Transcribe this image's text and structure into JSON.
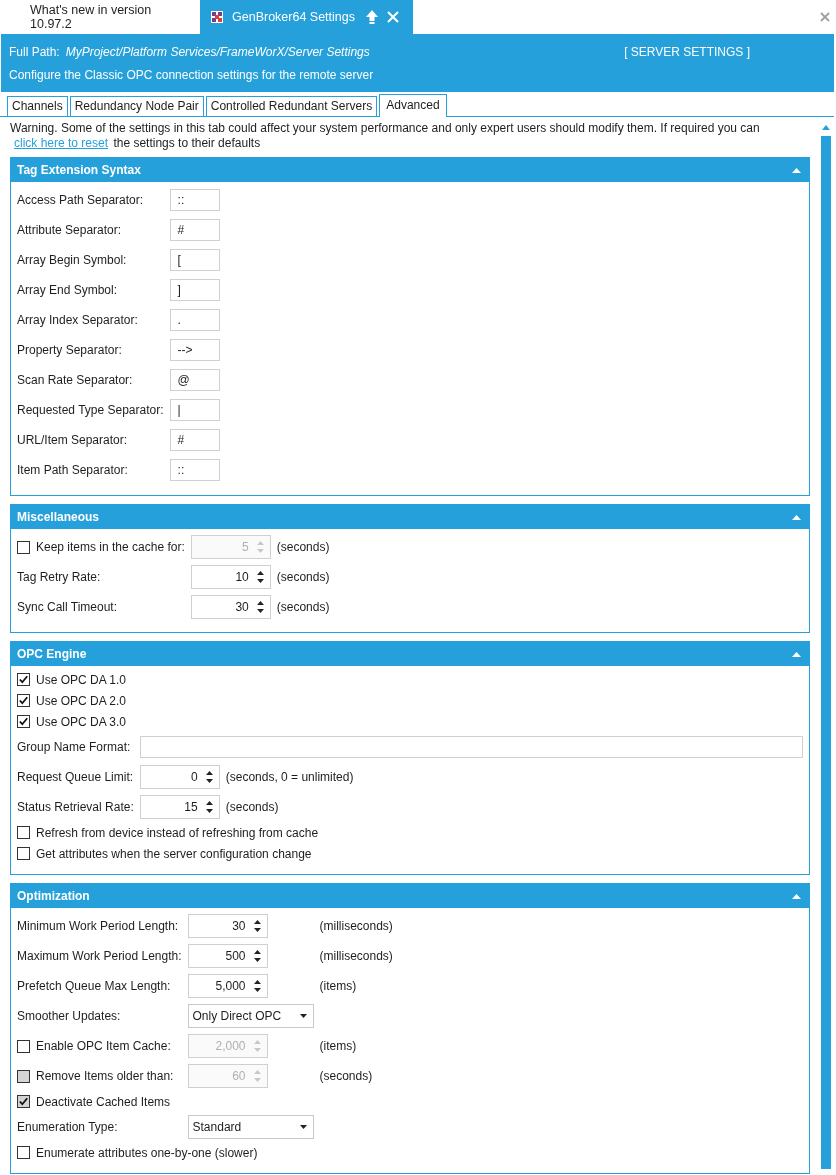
{
  "document_tabs": [
    {
      "label": "What's new in version 10.97.2",
      "selected": false
    },
    {
      "label": "GenBroker64 Settings",
      "selected": true
    }
  ],
  "header": {
    "path_label": "Full Path:",
    "path": "MyProject/Platform Services/FrameWorX/Server Settings",
    "title": "[ SERVER SETTINGS ]",
    "description": "Configure the Classic OPC connection settings for the remote server"
  },
  "tabs": [
    {
      "label": "Channels",
      "selected": false
    },
    {
      "label": "Redundancy Node Pair",
      "selected": false
    },
    {
      "label": "Controlled Redundant Servers",
      "selected": false
    },
    {
      "label": "Advanced",
      "selected": true
    }
  ],
  "warning": {
    "text": "Warning. Some of the settings in this tab could affect your system performance and only expert users should modify them.  If required you can ",
    "link": "click here to reset",
    "text_after": " the settings to their defaults"
  },
  "sections": [
    {
      "title": "Tag Extension Syntax",
      "expanded": true,
      "rows": [
        {
          "kind": "field",
          "label": "Access Path Separator:",
          "value": "::"
        },
        {
          "kind": "field",
          "label": "Attribute Separator:",
          "value": "#"
        },
        {
          "kind": "field",
          "label": "Array Begin Symbol:",
          "value": "["
        },
        {
          "kind": "field",
          "label": "Array End Symbol:",
          "value": "]"
        },
        {
          "kind": "field",
          "label": "Array Index Separator:",
          "value": "."
        },
        {
          "kind": "field",
          "label": "Property Separator:",
          "value": "-->"
        },
        {
          "kind": "field",
          "label": "Scan Rate Separator:",
          "value": "@"
        },
        {
          "kind": "field",
          "label": "Requested Type Separator:",
          "value": "|"
        },
        {
          "kind": "field",
          "label": "URL/Item Separator:",
          "value": "#"
        },
        {
          "kind": "field",
          "label": "Item Path Separator:",
          "value": "::"
        }
      ]
    },
    {
      "title": "Miscellaneous",
      "expanded": true,
      "rows": [
        {
          "kind": "check-spin",
          "label": "Keep items in the cache for:",
          "checked": false,
          "value": "5",
          "unit": "(seconds)",
          "disabled": true
        },
        {
          "kind": "spin",
          "label": "Tag Retry Rate:",
          "value": "10",
          "unit": "(seconds)",
          "disabled": false
        },
        {
          "kind": "spin",
          "label": "Sync Call Timeout:",
          "value": "30",
          "unit": "(seconds)",
          "disabled": false
        }
      ]
    },
    {
      "title": "OPC Engine",
      "expanded": true,
      "rows": [
        {
          "kind": "check",
          "label": "Use OPC DA 1.0",
          "checked": true,
          "disabled": false
        },
        {
          "kind": "check",
          "label": "Use OPC DA 2.0",
          "checked": true,
          "disabled": false
        },
        {
          "kind": "check",
          "label": "Use OPC DA 3.0",
          "checked": true,
          "disabled": false
        },
        {
          "kind": "wide-field",
          "label": "Group Name Format:"
        },
        {
          "kind": "spin",
          "label": "Request Queue Limit:",
          "value": "0",
          "unit": "(seconds, 0 = unlimited)",
          "disabled": false
        },
        {
          "kind": "spin",
          "label": "Status Retrieval Rate:",
          "value": "15",
          "unit": "(seconds)",
          "disabled": false
        },
        {
          "kind": "check",
          "label": "Refresh from device instead of refreshing from cache",
          "checked": false,
          "disabled": false
        },
        {
          "kind": "check",
          "label": "Get attributes when the server configuration change",
          "checked": false,
          "disabled": false
        }
      ]
    },
    {
      "title": "Optimization",
      "expanded": true,
      "rows": [
        {
          "kind": "spin",
          "label": "Minimum Work Period Length:",
          "value": "30",
          "unit": "(milliseconds)",
          "disabled": false
        },
        {
          "kind": "spin",
          "label": "Maximum Work Period Length:",
          "value": "500",
          "unit": "(milliseconds)",
          "disabled": false
        },
        {
          "kind": "spin",
          "label": "Prefetch Queue Max Length:",
          "value": "5,000",
          "unit": "(items)",
          "disabled": false
        },
        {
          "kind": "combo",
          "label": "Smoother Updates:",
          "value": "Only Direct OPC"
        },
        {
          "kind": "check-spin",
          "label": "Enable OPC Item Cache:",
          "checked": false,
          "value": "2,000",
          "unit": "(items)",
          "disabled": true
        },
        {
          "kind": "check-spin",
          "label": "Remove Items older than:",
          "checked": false,
          "check_disabled": true,
          "value": "60",
          "unit": "(seconds)",
          "disabled": true
        },
        {
          "kind": "check",
          "label": "Deactivate Cached Items",
          "checked": true,
          "disabled": true
        },
        {
          "kind": "combo",
          "label": "Enumeration Type:",
          "value": "Standard"
        },
        {
          "kind": "check",
          "label": "Enumerate attributes one-by-one (slower)",
          "checked": false,
          "disabled": false
        }
      ]
    }
  ]
}
